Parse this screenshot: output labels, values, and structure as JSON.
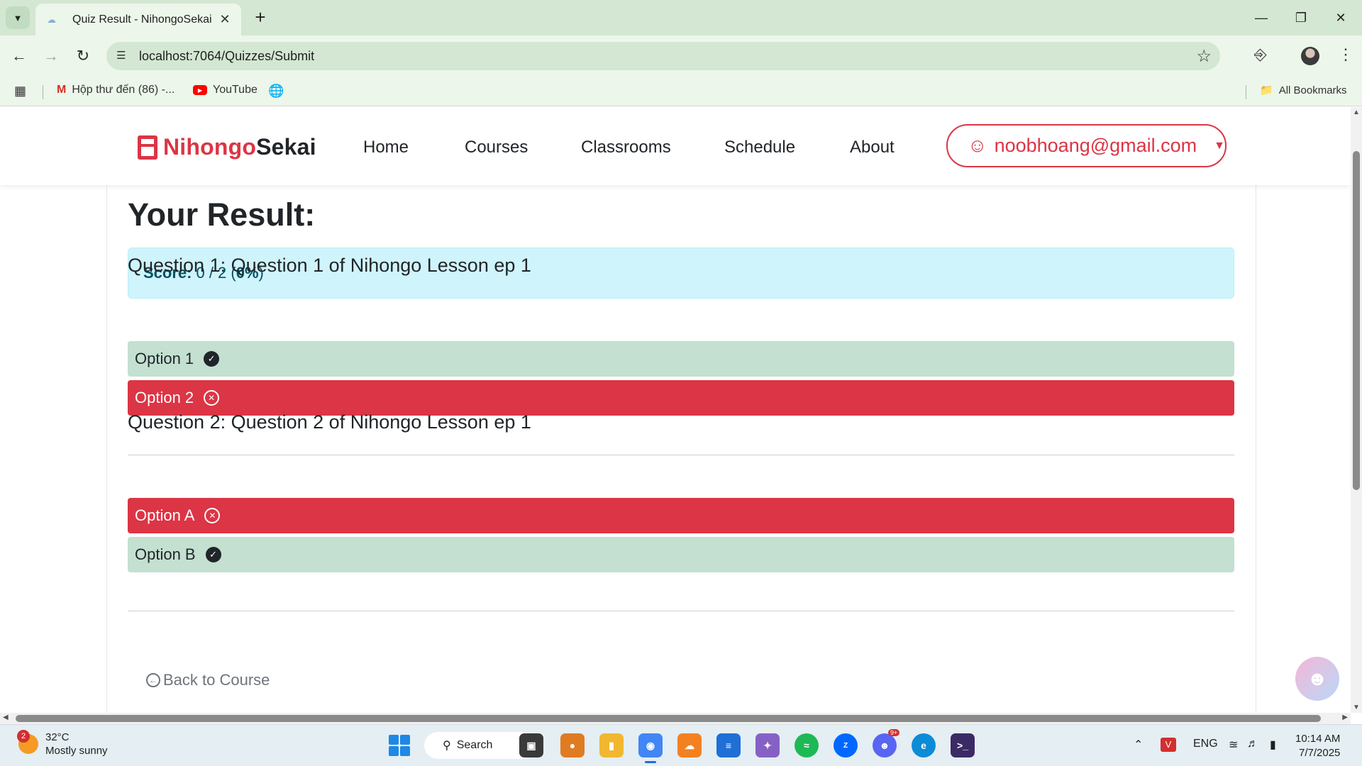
{
  "browser": {
    "tab_title": "Quiz Result - NihongoSekai",
    "url": "localhost:7064/Quizzes/Submit",
    "bookmarks": [
      {
        "label": "Hộp thư đến (86) -...",
        "icon": "gmail-icon"
      },
      {
        "label": "YouTube",
        "icon": "youtube-icon"
      }
    ],
    "all_bookmarks_label": "All Bookmarks"
  },
  "site": {
    "brand_part1": "Nihongo",
    "brand_part2": "Sekai",
    "nav": [
      "Home",
      "Courses",
      "Classrooms",
      "Schedule",
      "About"
    ],
    "user_email": "noobhoang@gmail.com"
  },
  "result": {
    "title": "Your Result:",
    "score_label": "Score:",
    "score_value": "0 / 2 (",
    "score_percent": "0%",
    "score_close": ")",
    "questions": [
      {
        "title": "Question 1: Question 1 of Nihongo Lesson ep 1",
        "options": [
          {
            "label": "Option 1",
            "status": "correct"
          },
          {
            "label": "Option 2",
            "status": "wrong"
          }
        ]
      },
      {
        "title": "Question 2: Question 2 of Nihongo Lesson ep 1",
        "options": [
          {
            "label": "Option A",
            "status": "wrong"
          },
          {
            "label": "Option B",
            "status": "correct"
          }
        ]
      }
    ],
    "back_label": "Back to Course"
  },
  "taskbar": {
    "weather_badge": "2",
    "temperature": "32°C",
    "condition": "Mostly sunny",
    "search_label": "Search",
    "lang": "ENG",
    "time": "10:14 AM",
    "date": "7/7/2025",
    "discord_badge": "9+"
  },
  "colors": {
    "brand_red": "#dc3545",
    "correct_bg": "#c3e0d1",
    "score_bg": "#cff4fc",
    "chrome_green": "#d3e7d2"
  }
}
